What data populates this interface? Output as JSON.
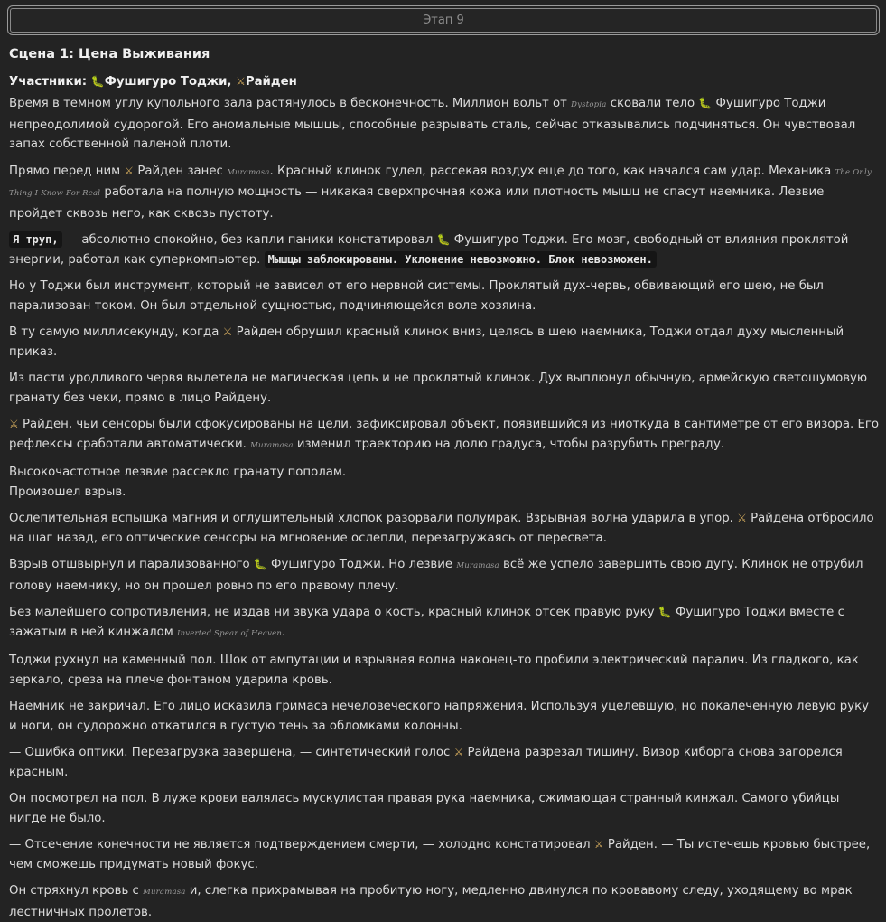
{
  "stage": {
    "label": "Этап 9"
  },
  "scene": {
    "title": "Сцена 1: Цена Выживания"
  },
  "participants": {
    "prefix": "Участники:",
    "toji": "Фушигуро Тоджи,",
    "raiden": "Райден"
  },
  "icons": {
    "toji": "worm-icon",
    "raiden": "sword-icon"
  },
  "p1": {
    "a": "Время в темном углу купольного зала растянулось в бесконечность. Миллион вольт от ",
    "e1": "Dystopia",
    "b": " сковали тело ",
    "c": "Фушигуро Тоджи непреодолимой судорогой. Его аномальные мышцы, способные разрывать сталь, сейчас отказывались подчиняться. Он чувствовал запах собственной паленой плоти."
  },
  "p2": {
    "a": "Прямо перед ним ",
    "b": "Райден занес ",
    "e1": "Muramasa",
    "c": ". Красный клинок гудел, рассекая воздух еще до того, как начался сам удар. Механика ",
    "e2": "The Only Thing I Know For Real",
    "d": " работала на полную мощность — никакая сверхпрочная кожа или плотность мышц не спасут наемника. Лезвие пройдет сквозь него, как сквозь пустоту."
  },
  "p3": {
    "code1": "Я труп,",
    "a": " — абсолютно спокойно, без капли паники констатировал ",
    "b": "Фушигуро Тоджи. Его мозг, свободный от влияния проклятой энергии, работал как суперкомпьютер. ",
    "code2": "Мышцы заблокированы. Уклонение невозможно. Блок невозможен."
  },
  "p4": "Но у Тоджи был инструмент, который не зависел от его нервной системы. Проклятый дух-червь, обвивающий его шею, не был парализован током. Он был отдельной сущностью, подчиняющейся воле хозяина.",
  "p5": {
    "a": "В ту самую миллисекунду, когда ",
    "b": "Райден обрушил красный клинок вниз, целясь в шею наемника, Тоджи отдал духу мысленный приказ."
  },
  "p6": "Из пасти уродливого червя вылетела не магическая цепь и не проклятый клинок. Дух выплюнул обычную, армейскую светошумовую гранату без чеки, прямо в лицо Райдену.",
  "p7": {
    "a": "Райден, чьи сенсоры были сфокусированы на цели, зафиксировал объект, появившийся из ниоткуда в сантиметре от его визора. Его рефлексы сработали автоматически. ",
    "e1": "Muramasa",
    "b": " изменил траекторию на долю градуса, чтобы разрубить преграду."
  },
  "p8": {
    "a": "Высокочастотное лезвие рассекло гранату пополам.",
    "b": "Произошел взрыв."
  },
  "p9": {
    "a": "Ослепительная вспышка магния и оглушительный хлопок разорвали полумрак. Взрывная волна ударила в упор. ",
    "b": "Райдена отбросило на шаг назад, его оптические сенсоры на мгновение ослепли, перезагружаясь от пересвета."
  },
  "p10": {
    "a": "Взрыв отшвырнул и парализованного ",
    "b": "Фушигуро Тоджи. Но лезвие ",
    "e1": "Muramasa",
    "c": " всё же успело завершить свою дугу. Клинок не отрубил голову наемнику, но он прошел ровно по его правому плечу."
  },
  "p11": {
    "a": "Без малейшего сопротивления, не издав ни звука удара о кость, красный клинок отсек правую руку ",
    "b": "Фушигуро Тоджи вместе с зажатым в ней кинжалом ",
    "e1": "Inverted Spear of Heaven",
    "c": "."
  },
  "p12": "Тоджи рухнул на каменный пол. Шок от ампутации и взрывная волна наконец-то пробили электрический паралич. Из гладкого, как зеркало, среза на плече фонтаном ударила кровь.",
  "p13": "Наемник не закричал. Его лицо исказила гримаса нечеловеческого напряжения. Используя уцелевшую, но покалеченную левую руку и ноги, он судорожно откатился в густую тень за обломками колонны.",
  "p14": {
    "a": "— Ошибка оптики. Перезагрузка завершена, — синтетический голос ",
    "b": "Райдена разрезал тишину. Визор киборга снова загорелся красным."
  },
  "p15": "Он посмотрел на пол. В луже крови валялась мускулистая правая рука наемника, сжимающая странный кинжал. Самого убийцы нигде не было.",
  "p16": {
    "a": "— Отсечение конечности не является подтверждением смерти, — холодно констатировал ",
    "b": "Райден. — Ты истечешь кровью быстрее, чем сможешь придумать новый фокус."
  },
  "p17": {
    "a": "Он стряхнул кровь с ",
    "e1": "Muramasa",
    "b": " и, слегка прихрамывая на пробитую ногу, медленно двинулся по кровавому следу, уходящему во мрак лестничных пролетов."
  }
}
